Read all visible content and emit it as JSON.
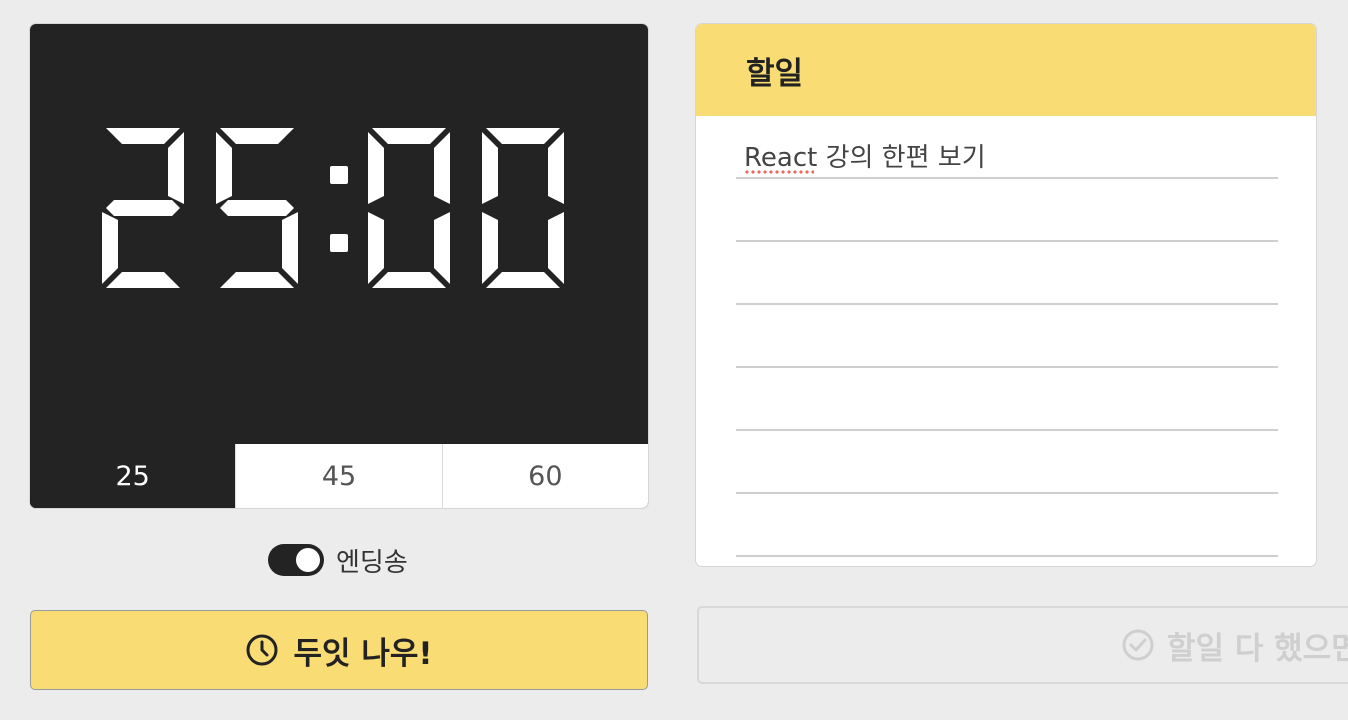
{
  "timer": {
    "display": "25:00",
    "durations": [
      {
        "label": "25",
        "active": true
      },
      {
        "label": "45",
        "active": false
      },
      {
        "label": "60",
        "active": false
      }
    ]
  },
  "ending_song": {
    "label": "엔딩송",
    "enabled": true
  },
  "start_button": {
    "label": "두잇 나우!",
    "icon": "clock-icon"
  },
  "todo": {
    "title": "할일",
    "items": [
      "React 강의 한편 보기",
      "",
      "",
      "",
      "",
      "",
      ""
    ]
  },
  "done_button": {
    "label": "할일 다 했으면",
    "icon": "check-circle-icon"
  },
  "colors": {
    "accent": "#f9dd74",
    "dark": "#232323",
    "page_bg": "#ececec"
  }
}
